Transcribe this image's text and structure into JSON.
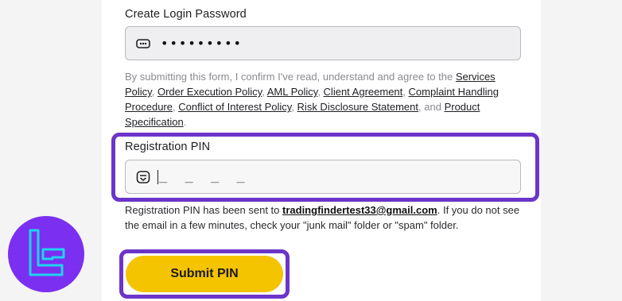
{
  "password_section": {
    "label": "Create Login Password",
    "value": "•••••••••",
    "icon": "password-dots-icon"
  },
  "consent": {
    "intro": "By submitting this form, I confirm I've read, understand and agree to the",
    "links": {
      "services": "Services Policy",
      "order": "Order Execution Policy",
      "aml": "AML Policy",
      "client": "Client Agreement",
      "complaint": "Complaint Handling Procedure",
      "conflict": "Conflict of Interest Policy",
      "risk": "Risk Disclosure Statement",
      "product": "Product Specification"
    },
    "and_word": "and"
  },
  "pin_section": {
    "label": "Registration PIN",
    "placeholder": "_ _ _ _",
    "icon": "pin-keypad-icon"
  },
  "notice": {
    "prefix": "Registration PIN has been sent to",
    "email": "tradingfindertest33@gmail.com",
    "suffix": ". If you do not see the email in a few minutes, check your \"junk mail\" folder or \"spam\" folder."
  },
  "submit": {
    "label": "Submit PIN"
  },
  "colors": {
    "highlight": "#6b35c9",
    "submit_bg": "#f5c400",
    "logo_bg": "#7b2ff0",
    "logo_stroke": "#1fd4f0"
  }
}
